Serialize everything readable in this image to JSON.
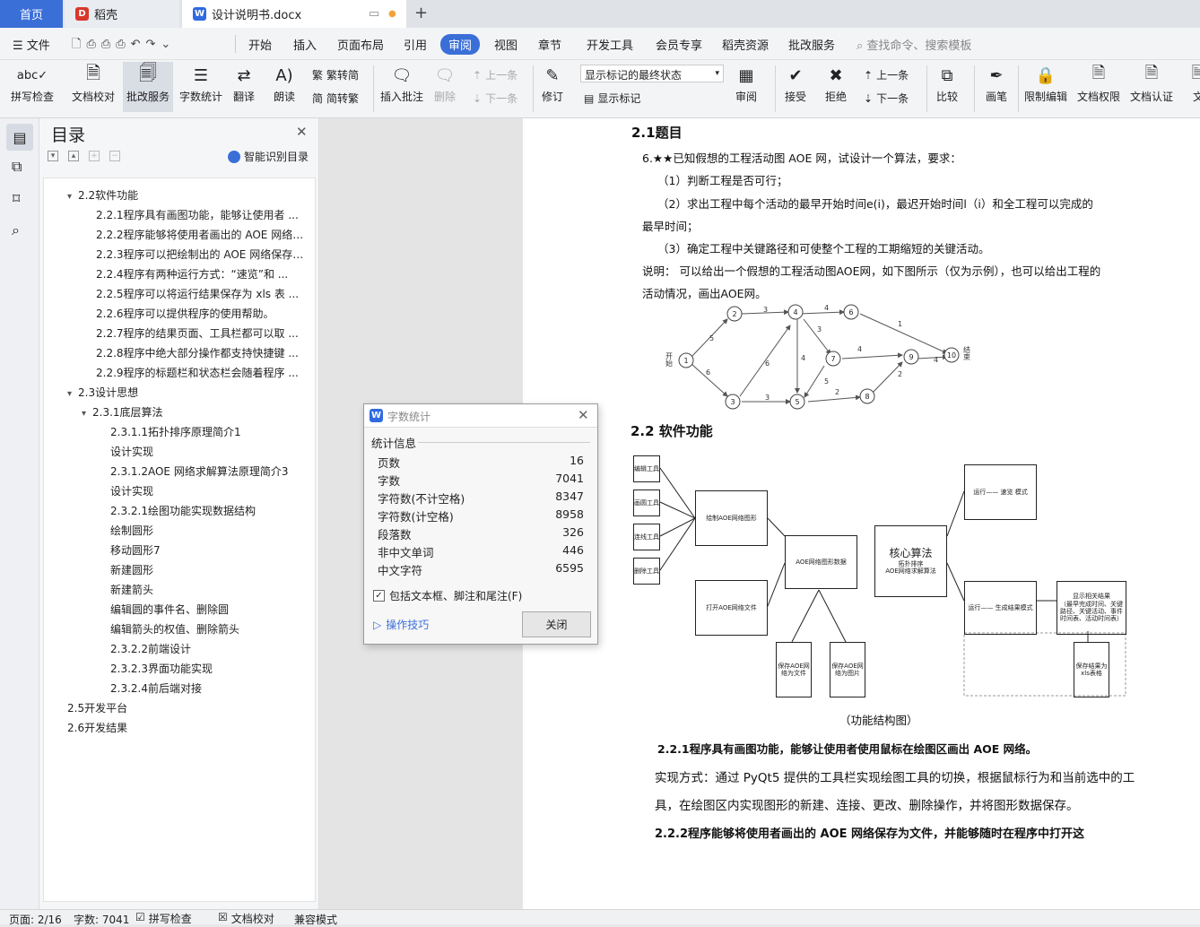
{
  "tabs": {
    "home": "首页",
    "daoke": "稻壳",
    "doc": "设计说明书.docx"
  },
  "menu": {
    "file": "文件",
    "items": [
      "开始",
      "插入",
      "页面布局",
      "引用",
      "审阅",
      "视图",
      "章节",
      "开发工具",
      "会员专享",
      "稻壳资源",
      "批改服务"
    ],
    "search": "查找命令、搜索模板"
  },
  "ribbon": {
    "spell": "拼写检查",
    "proof": "文档校对",
    "grade": "批改服务",
    "count": "字数统计",
    "translate": "翻译",
    "read": "朗读",
    "trad": "繁转简",
    "simp": "简转繁",
    "insert_comment": "插入批注",
    "delete": "删除",
    "prev": "上一条",
    "next": "下一条",
    "revise": "修订",
    "markup_select": "显示标记的最终状态",
    "show_markup": "显示标记",
    "review": "审阅",
    "accept": "接受",
    "reject": "拒绝",
    "prev2": "上一条",
    "next2": "下一条",
    "compare": "比较",
    "pen": "画笔",
    "restrict": "限制编辑",
    "perm": "文档权限",
    "cert": "文档认证",
    "more": "文"
  },
  "toc": {
    "title": "目录",
    "smart": "智能识别目录",
    "items": [
      {
        "t": "2.2软件功能",
        "lvl": 1,
        "c": "▾"
      },
      {
        "t": "2.2.1程序具有画图功能，能够让使用者 ...",
        "lvl": 2,
        "c": ""
      },
      {
        "t": "2.2.2程序能够将使用者画出的 AOE 网络 ...",
        "lvl": 2,
        "c": ""
      },
      {
        "t": "2.2.3程序可以把绘制出的 AOE 网络保存 ...",
        "lvl": 2,
        "c": ""
      },
      {
        "t": "2.2.4程序有两种运行方式：“速览”和 ...",
        "lvl": 2,
        "c": ""
      },
      {
        "t": "2.2.5程序可以将运行结果保存为 xls 表 ...",
        "lvl": 2,
        "c": ""
      },
      {
        "t": "2.2.6程序可以提供程序的使用帮助。",
        "lvl": 2,
        "c": ""
      },
      {
        "t": "2.2.7程序的结果页面、工具栏都可以取 ...",
        "lvl": 2,
        "c": ""
      },
      {
        "t": "2.2.8程序中绝大部分操作都支持快捷键 ...",
        "lvl": 2,
        "c": ""
      },
      {
        "t": "2.2.9程序的标题栏和状态栏会随着程序 ...",
        "lvl": 2,
        "c": ""
      },
      {
        "t": "2.3设计思想",
        "lvl": 1,
        "c": "▾"
      },
      {
        "t": "2.3.1底层算法",
        "lvl": 2,
        "c": "▾"
      },
      {
        "t": "2.3.1.1拓扑排序原理简介1",
        "lvl": 3,
        "c": ""
      },
      {
        "t": "设计实现",
        "lvl": 3,
        "c": ""
      },
      {
        "t": "2.3.1.2AOE 网络求解算法原理简介3",
        "lvl": 3,
        "c": ""
      },
      {
        "t": "设计实现",
        "lvl": 3,
        "c": ""
      },
      {
        "t": "2.3.2.1绘图功能实现数据结构",
        "lvl": 3,
        "c": ""
      },
      {
        "t": "绘制圆形",
        "lvl": 3,
        "c": ""
      },
      {
        "t": "移动圆形7",
        "lvl": 3,
        "c": ""
      },
      {
        "t": "新建圆形",
        "lvl": 3,
        "c": ""
      },
      {
        "t": "新建箭头",
        "lvl": 3,
        "c": ""
      },
      {
        "t": "编辑圆的事件名、删除圆",
        "lvl": 3,
        "c": ""
      },
      {
        "t": "编辑箭头的权值、删除箭头",
        "lvl": 3,
        "c": ""
      },
      {
        "t": "2.3.2.2前端设计",
        "lvl": 3,
        "c": ""
      },
      {
        "t": "2.3.2.3界面功能实现",
        "lvl": 3,
        "c": ""
      },
      {
        "t": "2.3.2.4前后端对接",
        "lvl": 3,
        "c": ""
      },
      {
        "t": "2.5开发平台",
        "lvl": 1,
        "c": ""
      },
      {
        "t": "2.6开发结果",
        "lvl": 1,
        "c": ""
      }
    ]
  },
  "dialog": {
    "title": "字数统计",
    "section": "统计信息",
    "rows": [
      {
        "k": "页数",
        "v": "16"
      },
      {
        "k": "字数",
        "v": "7041"
      },
      {
        "k": "字符数(不计空格)",
        "v": "8347"
      },
      {
        "k": "字符数(计空格)",
        "v": "8958"
      },
      {
        "k": "段落数",
        "v": "326"
      },
      {
        "k": "非中文单词",
        "v": "446"
      },
      {
        "k": "中文字符",
        "v": "6595"
      }
    ],
    "checkbox": "包括文本框、脚注和尾注(F)",
    "tips": "操作技巧",
    "close": "关闭"
  },
  "doc": {
    "h1": "2.1题目",
    "l1": "6.★★已知假想的工程活动图 AOE 网，试设计一个算法，要求：",
    "l2": "（1）判断工程是否可行；",
    "l3": "（2）求出工程中每个活动的最早开始时间e(i)，最迟开始时间l（i）和全工程可以完成的",
    "l4": "最早时间；",
    "l5": "（3）确定工程中关键路径和可使整个工程的工期缩短的关键活动。",
    "l6": "说明： 可以给出一个假想的工程活动图AOE网，如下图所示（仅为示例），也可以给出工程的",
    "l7": "活动情况，画出AOE网。",
    "h2": "2.2 软件功能",
    "caption": "（功能结构图）",
    "h3": "2.2.1程序具有画图功能，能够让使用者使用鼠标在绘图区画出 AOE 网络。",
    "p1": "实现方式：通过 PyQt5 提供的工具栏实现绘图工具的切换，根据鼠标行为和当前选中的工",
    "p2": "具，在绘图区内实现图形的新建、连接、更改、删除操作，并将图形数据保存。",
    "h4": "2.2.2程序能够将使用者画出的 AOE 网络保存为文件，并能够随时在程序中打开这",
    "graph": {
      "start": "开始",
      "end": "结束",
      "nodes": [
        "1",
        "2",
        "3",
        "4",
        "5",
        "6",
        "7",
        "8",
        "9",
        "10"
      ],
      "weights": [
        "5",
        "6",
        "3",
        "6",
        "3",
        "4",
        "4",
        "3",
        "1",
        "5",
        "4",
        "2",
        "2",
        "4"
      ]
    },
    "func": {
      "tools": [
        "编辑工具",
        "画圆工具",
        "连线工具",
        "删除工具"
      ],
      "draw": "绘制AOE网络图形",
      "open": "打开AOE网络文件",
      "data": "AOE网络图形数据",
      "save1": "保存AOE网络为文件",
      "save2": "保存AOE网络为图片",
      "core": "核心算法",
      "core_sub1": "拓扑排序",
      "core_sub2": "AOE网络求解算法",
      "run1": "运行—— 速览 模式",
      "run2": "运行—— 生成结果模式",
      "show": "显示相关结果",
      "show_sub": "（最早完成时间、关键路径、关键活动、事件时间表、活动时间表）",
      "save3": "保存结果为xls表格"
    }
  },
  "status": {
    "page": "页面: 2/16",
    "words": "字数: 7041",
    "spell": "拼写检查",
    "proof": "文档校对",
    "compat": "兼容模式"
  },
  "colors": {
    "accent": "#3b6fd8",
    "wps_red": "#d9362b"
  }
}
